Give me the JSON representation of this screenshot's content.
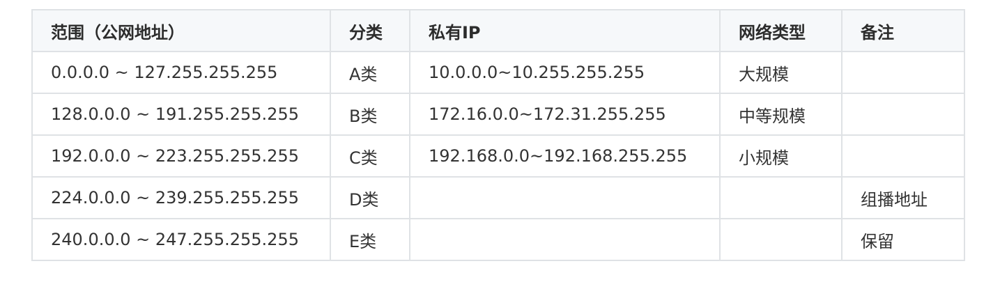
{
  "table": {
    "headers": [
      "范围（公网地址）",
      "分类",
      "私有IP",
      "网络类型",
      "备注"
    ],
    "rows": [
      [
        "0.0.0.0 ~ 127.255.255.255",
        "A类",
        "10.0.0.0~10.255.255.255",
        "大规模",
        ""
      ],
      [
        "128.0.0.0 ~ 191.255.255.255",
        "B类",
        "172.16.0.0~172.31.255.255",
        "中等规模",
        ""
      ],
      [
        "192.0.0.0 ~ 223.255.255.255",
        "C类",
        "192.168.0.0~192.168.255.255",
        "小规模",
        ""
      ],
      [
        "224.0.0.0 ~ 239.255.255.255",
        "D类",
        "",
        "",
        "组播地址"
      ],
      [
        "240.0.0.0 ~ 247.255.255.255",
        "E类",
        "",
        "",
        "保留"
      ]
    ]
  },
  "colors": {
    "border": "#dfe2e5",
    "header_background": "#f6f8fa",
    "text": "#333333"
  }
}
